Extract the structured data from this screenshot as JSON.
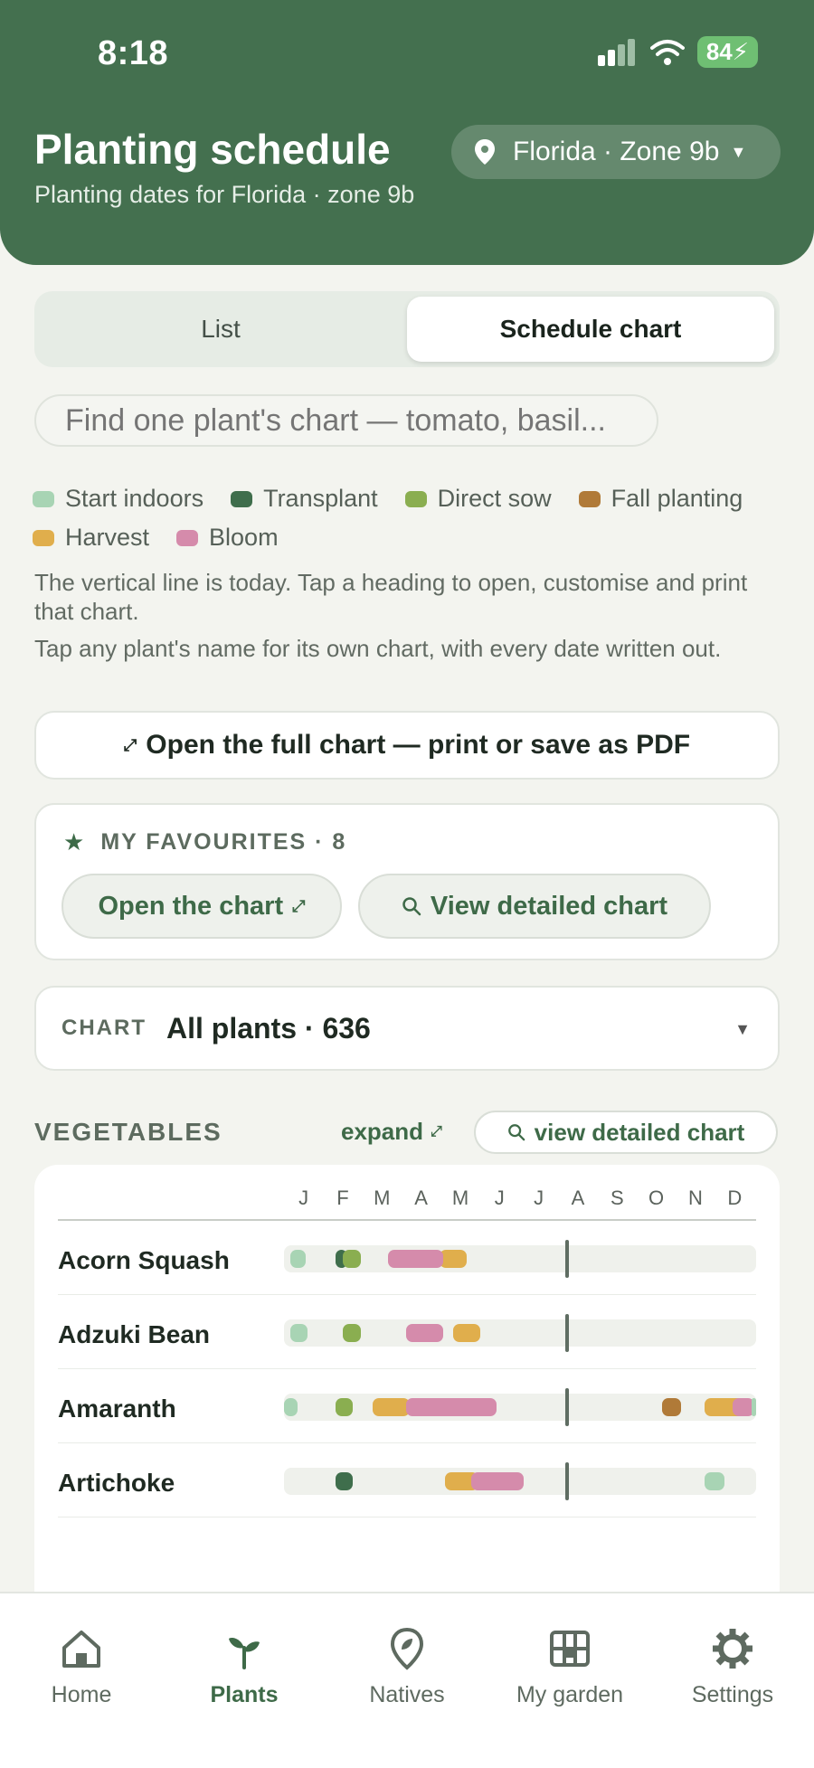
{
  "status_bar": {
    "time": "8:18",
    "battery": "84"
  },
  "header": {
    "title": "Planting schedule",
    "subtitle": "Planting dates for Florida · zone 9b",
    "location": "Florida · Zone 9b"
  },
  "view_toggle": {
    "list": "List",
    "chart": "Schedule chart",
    "selected": "Schedule chart"
  },
  "search": {
    "placeholder": "Find one plant's chart — tomato, basil..."
  },
  "legend": [
    {
      "label": "Start indoors",
      "color": "#a8d4b4"
    },
    {
      "label": "Transplant",
      "color": "#3f6e4c"
    },
    {
      "label": "Direct sow",
      "color": "#8aae50"
    },
    {
      "label": "Fall planting",
      "color": "#b07a38"
    },
    {
      "label": "Harvest",
      "color": "#e0ae4c"
    },
    {
      "label": "Bloom",
      "color": "#d58bab"
    }
  ],
  "help": {
    "line1": "The vertical line is today. Tap a heading to open, customise and print that chart.",
    "line2": "Tap any plant's name for its own chart, with every date written out."
  },
  "open_full": "Open the full chart — print or save as PDF",
  "favourites": {
    "heading": "MY FAVOURITES · 8",
    "open_chart": "Open the chart",
    "view_detailed": "View detailed chart"
  },
  "chart_select": {
    "label": "CHART",
    "value": "All plants · 636"
  },
  "section": {
    "title": "VEGETABLES",
    "expand": "expand",
    "view_detailed": "view detailed chart"
  },
  "months": [
    "J",
    "F",
    "M",
    "A",
    "M",
    "J",
    "J",
    "A",
    "S",
    "O",
    "N",
    "D"
  ],
  "schedule": {
    "today_month": 7.15,
    "plants": [
      {
        "name": "Acorn Squash",
        "bars": [
          {
            "kind": "Start indoors",
            "start": 0.15,
            "end": 0.55
          },
          {
            "kind": "Transplant",
            "start": 1.3,
            "end": 1.6
          },
          {
            "kind": "Direct sow",
            "start": 1.5,
            "end": 1.95
          },
          {
            "kind": "Harvest",
            "start": 3.95,
            "end": 4.65
          },
          {
            "kind": "Bloom",
            "start": 2.65,
            "end": 4.05
          }
        ]
      },
      {
        "name": "Adzuki Bean",
        "bars": [
          {
            "kind": "Start indoors",
            "start": 0.15,
            "end": 0.6
          },
          {
            "kind": "Direct sow",
            "start": 1.5,
            "end": 1.95
          },
          {
            "kind": "Bloom",
            "start": 3.1,
            "end": 4.05
          },
          {
            "kind": "Harvest",
            "start": 4.3,
            "end": 5.0
          }
        ]
      },
      {
        "name": "Amaranth",
        "bars": [
          {
            "kind": "Start indoors",
            "start": 0.0,
            "end": 0.35
          },
          {
            "kind": "Direct sow",
            "start": 1.3,
            "end": 1.75
          },
          {
            "kind": "Harvest",
            "start": 2.25,
            "end": 3.2
          },
          {
            "kind": "Bloom",
            "start": 3.1,
            "end": 5.4
          },
          {
            "kind": "Fall planting",
            "start": 9.6,
            "end": 10.1
          },
          {
            "kind": "Harvest",
            "start": 10.7,
            "end": 11.75
          },
          {
            "kind": "Bloom",
            "start": 11.4,
            "end": 11.95
          },
          {
            "kind": "Start indoors",
            "start": 11.88,
            "end": 12.0
          }
        ]
      },
      {
        "name": "Artichoke",
        "bars": [
          {
            "kind": "Transplant",
            "start": 1.3,
            "end": 1.75
          },
          {
            "kind": "Harvest",
            "start": 4.1,
            "end": 4.95
          },
          {
            "kind": "Bloom",
            "start": 4.75,
            "end": 6.1
          },
          {
            "kind": "Start indoors",
            "start": 10.7,
            "end": 11.2
          }
        ]
      }
    ]
  },
  "tabs": [
    {
      "label": "Home",
      "icon": "home-icon"
    },
    {
      "label": "Plants",
      "icon": "sprout-icon"
    },
    {
      "label": "Natives",
      "icon": "map-pin-leaf-icon"
    },
    {
      "label": "My garden",
      "icon": "grid-icon"
    },
    {
      "label": "Settings",
      "icon": "gear-icon"
    }
  ],
  "active_tab": "Plants",
  "colors": {
    "brand": "#44704f",
    "accent": "#3e6a48",
    "background": "#f3f4ef"
  }
}
